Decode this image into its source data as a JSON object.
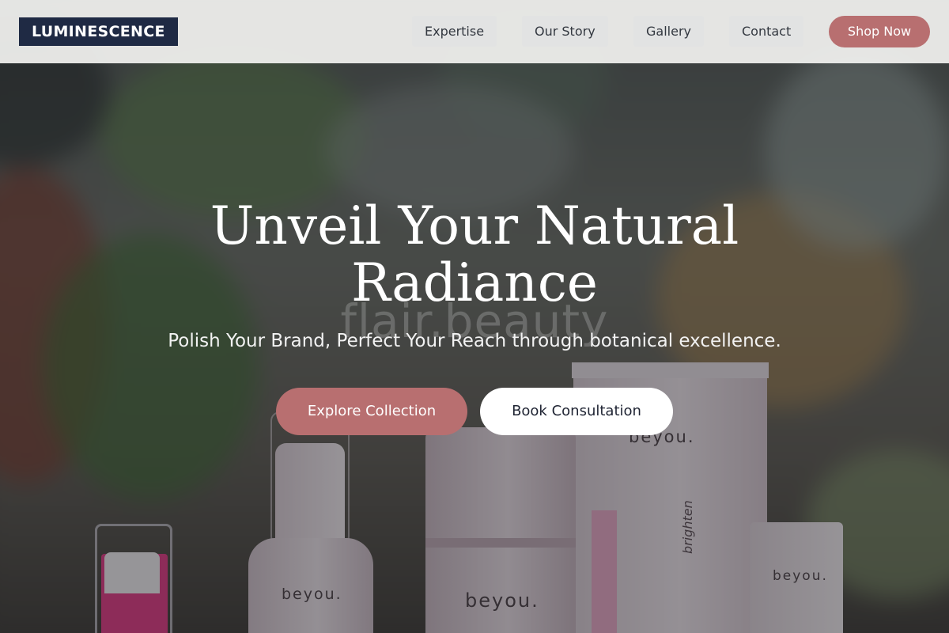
{
  "header": {
    "logo": "LUMINESCENCE",
    "nav": [
      "Expertise",
      "Our Story",
      "Gallery",
      "Contact"
    ],
    "cta": "Shop Now"
  },
  "hero": {
    "title": "Unveil Your Natural Radiance",
    "subtitle": "Polish Your Brand, Perfect Your Reach through botanical excellence.",
    "primary_button": "Explore Collection",
    "secondary_button": "Book Consultation",
    "background": {
      "watermark": "flair.beauty",
      "product_labels": [
        "beyou.",
        "beyou.",
        "beyou.",
        "beyou."
      ],
      "tube_text": "brighten"
    }
  },
  "colors": {
    "accent": "#b86f70",
    "logo_bg": "#1f2a44",
    "nav_bg": "#e2e3e3"
  }
}
